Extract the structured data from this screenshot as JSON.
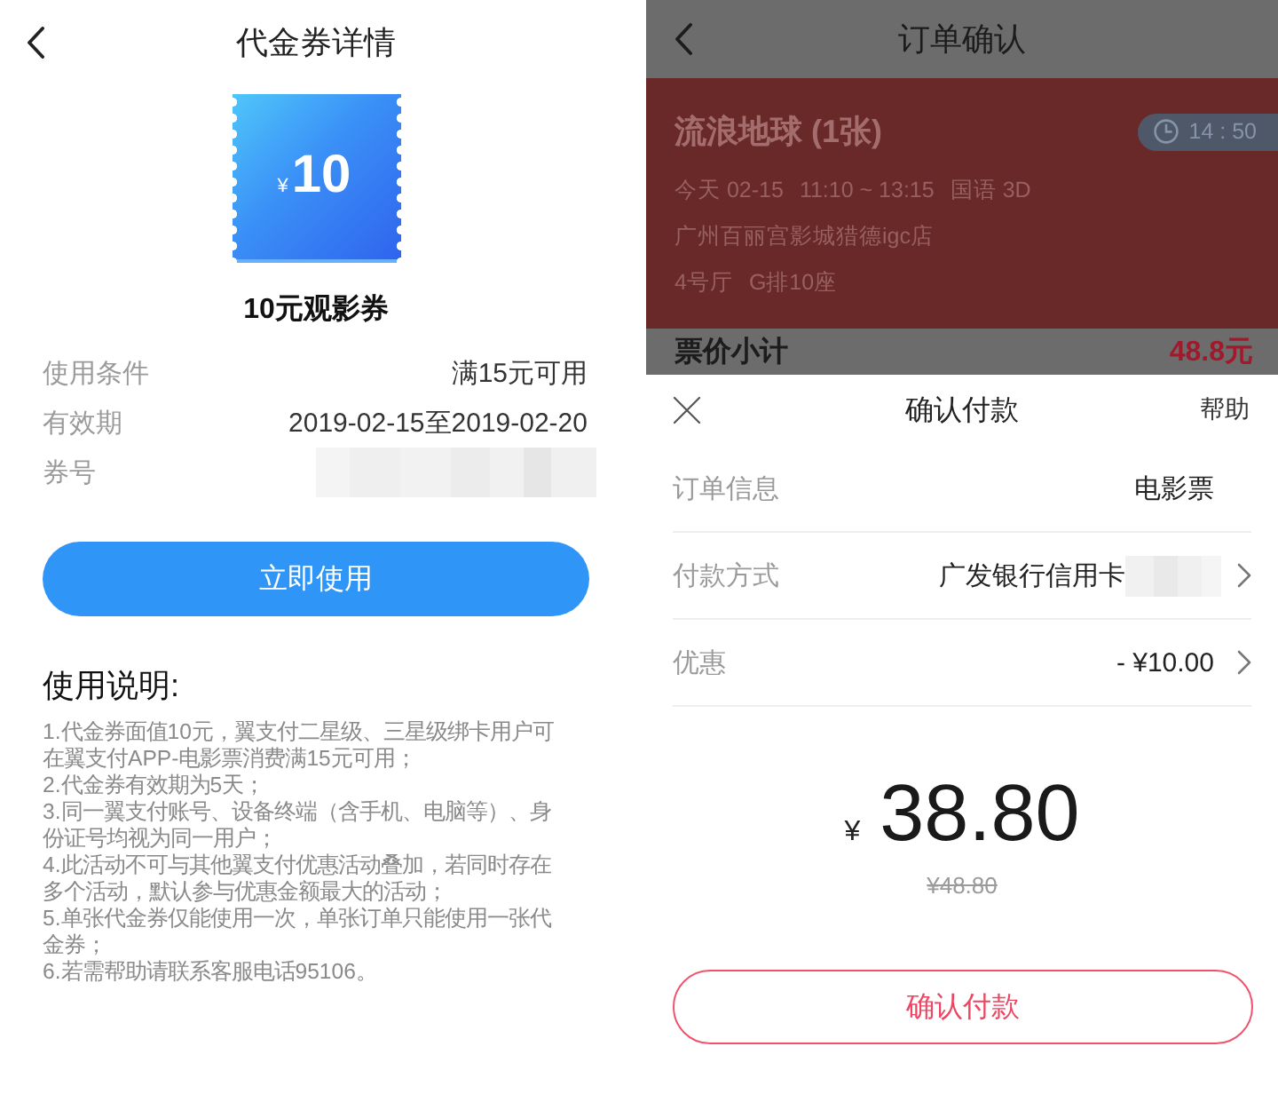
{
  "coupon_screen": {
    "header": {
      "title": "代金券详情"
    },
    "coupon": {
      "currency": "¥",
      "amount": "10",
      "name": "10元观影券"
    },
    "details": [
      {
        "label": "使用条件",
        "value": "满15元可用",
        "masked": false
      },
      {
        "label": "有效期",
        "value": "2019-02-15至2019-02-20",
        "masked": false
      },
      {
        "label": "券号",
        "masked": true
      }
    ],
    "button": "立即使用",
    "instructions": {
      "title": "使用说明:",
      "items": [
        "1.代金券面值10元，翼支付二星级、三星级绑卡用户可在翼支付APP-电影票消费满15元可用；",
        "2.代金券有效期为5天；",
        "3.同一翼支付账号、设备终端（含手机、电脑等）、身份证号均视为同一用户；",
        "4.此活动不可与其他翼支付优惠活动叠加，若同时存在多个活动，默认参与优惠金额最大的活动；",
        "5.单张代金券仅能使用一次，单张订单只能使用一张代金券；",
        "6.若需帮助请联系客服电话95106。"
      ]
    }
  },
  "order_screen": {
    "dimmed": true,
    "header": {
      "title": "订单确认"
    },
    "movie": {
      "title": "流浪地球 (1张)",
      "countdown": "14 : 50",
      "showtime": [
        "今天 02-15",
        "11:10 ~ 13:15",
        "国语 3D"
      ],
      "cinema": "广州百丽宫影城猎德igc店",
      "seat": [
        "4号厅",
        "G排10座"
      ]
    },
    "subtotal": {
      "label": "票价小计",
      "amount": "48.8元"
    },
    "payment_sheet": {
      "title": "确认付款",
      "help": "帮助",
      "rows": [
        {
          "label": "订单信息",
          "value": "电影票",
          "masked_suffix": false,
          "chevron": false
        },
        {
          "label": "付款方式",
          "value": "广发银行信用卡",
          "masked_suffix": true,
          "chevron": true
        },
        {
          "label": "优惠",
          "value": "- ¥10.00",
          "masked_suffix": false,
          "chevron": true
        }
      ],
      "amount": {
        "currency": "¥",
        "value": "38.80",
        "original": "¥48.80"
      },
      "button": "确认付款"
    }
  }
}
